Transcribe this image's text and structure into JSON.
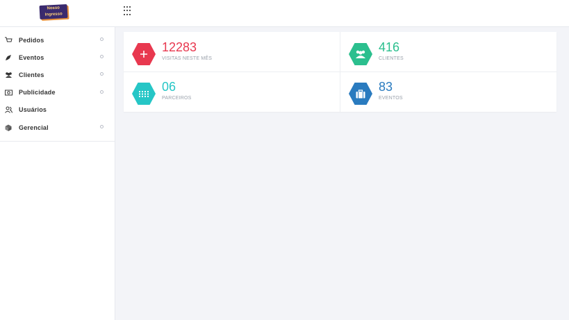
{
  "header": {
    "logo_text_1": "Nosso",
    "logo_text_2": "Ingresso",
    "apps_icon": "grid-icon"
  },
  "sidebar": {
    "items": [
      {
        "label": "Pedidos",
        "icon": "cart-icon",
        "has_submenu": true
      },
      {
        "label": "Eventos",
        "icon": "rocket-icon",
        "has_submenu": true
      },
      {
        "label": "Clientes",
        "icon": "users-icon",
        "has_submenu": true
      },
      {
        "label": "Publicidade",
        "icon": "money-icon",
        "has_submenu": true
      },
      {
        "label": "Usuários",
        "icon": "user-group-icon",
        "has_submenu": false
      },
      {
        "label": "Gerencial",
        "icon": "cube-icon",
        "has_submenu": true
      }
    ]
  },
  "stats": [
    {
      "value": "12283",
      "label": "VISITAS NESTE MÊS",
      "color": "#e8384f",
      "icon": "plus-icon"
    },
    {
      "value": "416",
      "label": "CLIENTES",
      "color": "#2bbf8e",
      "icon": "users-icon"
    },
    {
      "value": "06",
      "label": "PARCEIROS",
      "color": "#26c6c6",
      "icon": "grid-icon"
    },
    {
      "value": "83",
      "label": "EVENTOS",
      "color": "#2a7bbf",
      "icon": "briefcase-icon"
    }
  ],
  "colors": {
    "background": "#f3f4f8",
    "card": "#ffffff",
    "label": "#9aa1ab"
  }
}
